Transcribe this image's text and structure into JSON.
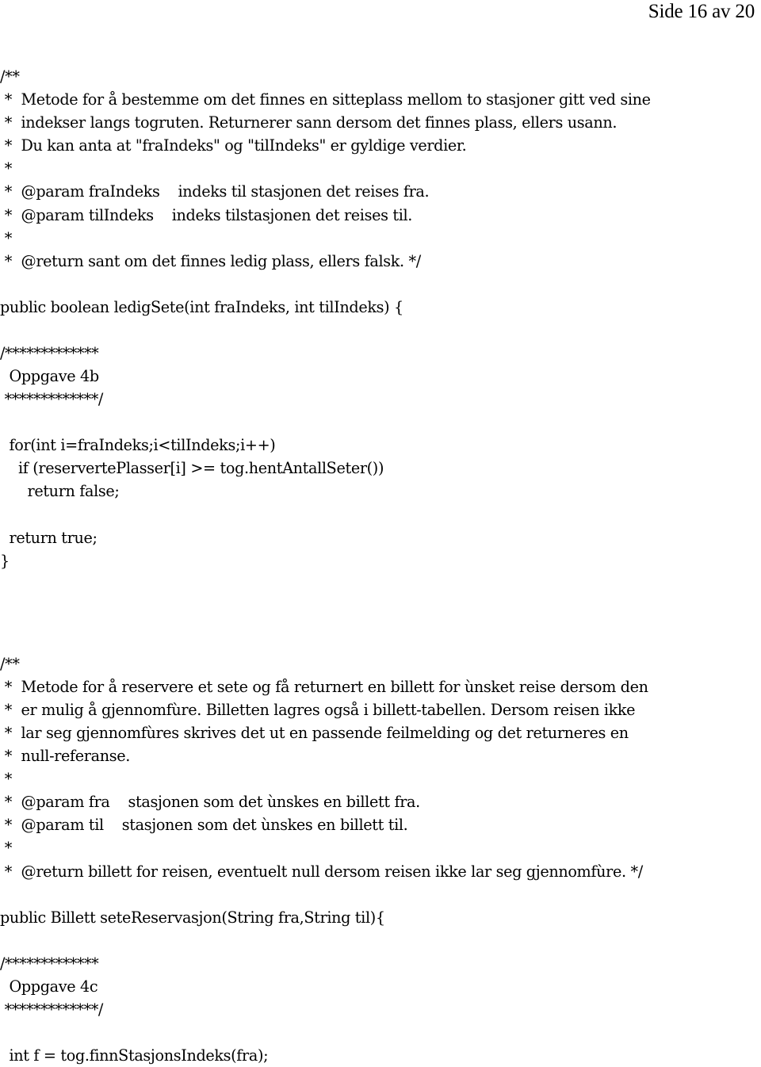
{
  "header": {
    "page_label": "Side 16 av 20",
    "page_number": 16,
    "page_total": 20
  },
  "document": {
    "language": "no",
    "kind": "java-source-listing",
    "blocks": [
      {
        "name": "javadoc-ledigsete",
        "lines": [
          "/**",
          " *  Metode for å bestemme om det finnes en sitteplass mellom to stasjoner gitt ved sine",
          " *  indekser langs togruten. Returnerer sann dersom det finnes plass, ellers usann.",
          " *  Du kan anta at \"fraIndeks\" og \"tilIndeks\" er gyldige verdier.",
          " *",
          " *  @param fraIndeks    indeks til stasjonen det reises fra.",
          " *  @param tilIndeks    indeks tilstasjonen det reises til.",
          " *",
          " *  @return sant om det finnes ledig plass, ellers falsk. */"
        ]
      },
      {
        "name": "signature-ledigsete",
        "lines": [
          "public boolean ledigSete(int fraIndeks, int tilIndeks) {"
        ]
      },
      {
        "name": "banner-oppgave-4b",
        "lines": [
          "/*************",
          "  Oppgave 4b",
          " *************/"
        ]
      },
      {
        "name": "code-ledigsete-body",
        "lines": [
          "  for(int i=fraIndeks;i<tilIndeks;i++)",
          "    if (reservertePlasser[i] >= tog.hentAntallSeter())",
          "      return false;",
          "",
          "  return true;",
          "}"
        ]
      },
      {
        "name": "javadoc-setereservasjon",
        "lines": [
          "/**",
          " *  Metode for å reservere et sete og få returnert en billett for ùnsket reise dersom den",
          " *  er mulig å gjennomfùre. Billetten lagres også i billett-tabellen. Dersom reisen ikke",
          " *  lar seg gjennomfùres skrives det ut en passende feilmelding og det returneres en",
          " *  null-referanse.",
          " *",
          " *  @param fra    stasjonen som det ùnskes en billett fra.",
          " *  @param til    stasjonen som det ùnskes en billett til.",
          " *",
          " *  @return billett for reisen, eventuelt null dersom reisen ikke lar seg gjennomfùre. */"
        ]
      },
      {
        "name": "signature-setereservasjon",
        "lines": [
          "public Billett seteReservasjon(String fra,String til){"
        ]
      },
      {
        "name": "banner-oppgave-4c",
        "lines": [
          "/*************",
          "  Oppgave 4c",
          " *************/"
        ]
      },
      {
        "name": "code-setereservasjon-body",
        "lines": [
          "  int f = tog.finnStasjonsIndeks(fra);"
        ]
      }
    ]
  },
  "lines": {
    "l01": "/**",
    "l02": " *  Metode for å bestemme om det finnes en sitteplass mellom to stasjoner gitt ved sine",
    "l03": " *  indekser langs togruten. Returnerer sann dersom det finnes plass, ellers usann.",
    "l04": " *  Du kan anta at \"fraIndeks\" og \"tilIndeks\" er gyldige verdier.",
    "l05": " *",
    "l06": " *  @param fraIndeks    indeks til stasjonen det reises fra.",
    "l07": " *  @param tilIndeks    indeks tilstasjonen det reises til.",
    "l08": " *",
    "l09": " *  @return sant om det finnes ledig plass, ellers falsk. */",
    "l10": "public boolean ledigSete(int fraIndeks, int tilIndeks) {",
    "l11": "/*************",
    "l12": "  Oppgave 4b",
    "l13": " *************/",
    "l14": "  for(int i=fraIndeks;i<tilIndeks;i++)",
    "l15": "    if (reservertePlasser[i] >= tog.hentAntallSeter())",
    "l16": "      return false;",
    "l17": "  return true;",
    "l18": "}",
    "l19": "/**",
    "l20": " *  Metode for å reservere et sete og få returnert en billett for ùnsket reise dersom den",
    "l21": " *  er mulig å gjennomfùre. Billetten lagres også i billett-tabellen. Dersom reisen ikke",
    "l22": " *  lar seg gjennomfùres skrives det ut en passende feilmelding og det returneres en",
    "l23": " *  null-referanse.",
    "l24": " *",
    "l25": " *  @param fra    stasjonen som det ùnskes en billett fra.",
    "l26": " *  @param til    stasjonen som det ùnskes en billett til.",
    "l27": " *",
    "l28": " *  @return billett for reisen, eventuelt null dersom reisen ikke lar seg gjennomfùre. */",
    "l29": "public Billett seteReservasjon(String fra,String til){",
    "l30": "/*************",
    "l31": "  Oppgave 4c",
    "l32": " *************/",
    "l33": "  int f = tog.finnStasjonsIndeks(fra);"
  },
  "colors": {
    "page_background": "#ffffff",
    "text": "#000000"
  }
}
